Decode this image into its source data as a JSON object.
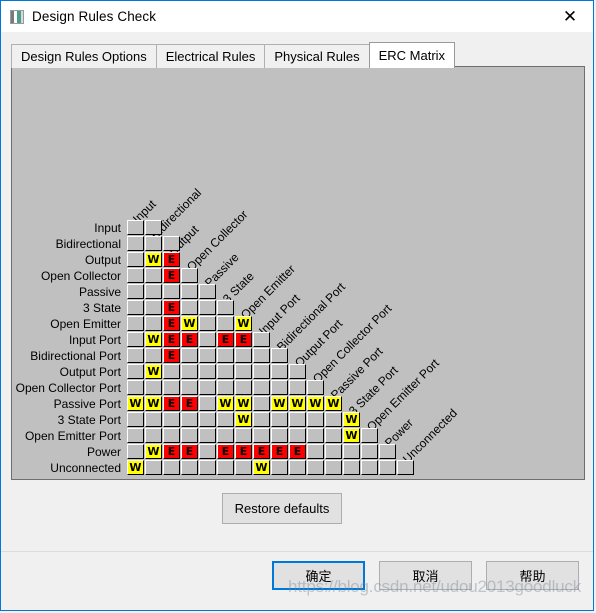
{
  "window": {
    "title": "Design Rules Check",
    "close_icon": "close-icon",
    "app_icon": "app-icon"
  },
  "tabs": [
    {
      "label": "Design Rules Options",
      "active": false
    },
    {
      "label": "Electrical Rules",
      "active": false
    },
    {
      "label": "Physical Rules",
      "active": false
    },
    {
      "label": "ERC Matrix",
      "active": true
    }
  ],
  "matrix": {
    "labels": [
      "Input",
      "Bidirectional",
      "Output",
      "Open Collector",
      "Passive",
      "3 State",
      "Open Emitter",
      "Input Port",
      "Bidirectional Port",
      "Output Port",
      "Open Collector Port",
      "Passive Port",
      "3 State Port",
      "Open Emitter Port",
      "Power",
      "Unconnected"
    ],
    "legend": {
      "warning": "W",
      "error": "E",
      "none": ""
    },
    "colors": {
      "warning_bg": "#ffff00",
      "error_bg": "#ff0000",
      "none_bg": "#c0c0c0"
    },
    "rows": [
      [
        "",
        ""
      ],
      [
        "",
        "",
        ""
      ],
      [
        "",
        "W",
        "E"
      ],
      [
        "",
        "",
        "E",
        ""
      ],
      [
        "",
        "",
        "",
        "",
        ""
      ],
      [
        "",
        "",
        "E",
        "",
        "",
        ""
      ],
      [
        "",
        "",
        "E",
        "W",
        "",
        "",
        "W"
      ],
      [
        "",
        "W",
        "E",
        "E",
        "",
        "E",
        "E",
        ""
      ],
      [
        "",
        "",
        "E",
        "",
        "",
        "",
        "",
        "",
        ""
      ],
      [
        "",
        "W",
        "",
        "",
        "",
        "",
        "",
        "",
        "",
        ""
      ],
      [
        "",
        "",
        "",
        "",
        "",
        "",
        "",
        "",
        "",
        "",
        ""
      ],
      [
        "W",
        "W",
        "E",
        "E",
        "",
        "W",
        "W",
        "",
        "W",
        "W",
        "W",
        "W"
      ],
      [
        "",
        "",
        "",
        "",
        "",
        "",
        "W",
        "",
        "",
        "",
        "",
        "",
        "W"
      ],
      [
        "",
        "",
        "",
        "",
        "",
        "",
        "",
        "",
        "",
        "",
        "",
        "",
        "W",
        ""
      ],
      [
        "",
        "W",
        "E",
        "E",
        "",
        "E",
        "E",
        "E",
        "E",
        "E",
        "",
        "",
        "",
        "",
        ""
      ],
      [
        "W",
        "",
        "",
        "",
        "",
        "",
        "",
        "W",
        "",
        "",
        "",
        "",
        "",
        "",
        "",
        ""
      ]
    ]
  },
  "restore_button": {
    "label": "Restore defaults"
  },
  "footer": {
    "ok_label": "确定",
    "cancel_label": "取消",
    "help_label": "帮助",
    "watermark": "https://blog.csdn.net/udou2013goodluck"
  }
}
